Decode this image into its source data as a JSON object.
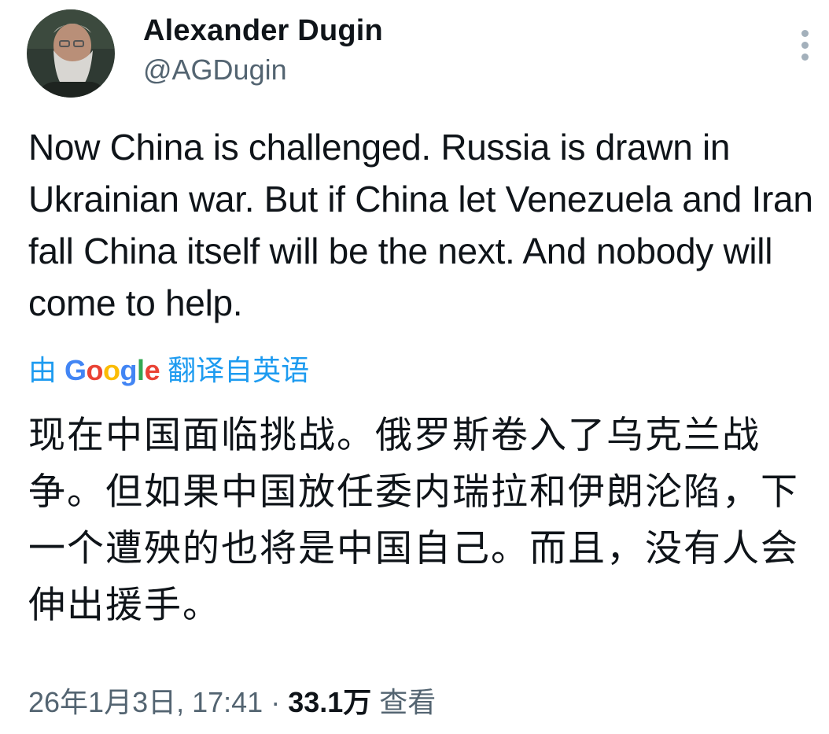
{
  "author": {
    "name": "Alexander Dugin",
    "handle": "@AGDugin",
    "avatar_icon": "profile-photo"
  },
  "tweet": {
    "text": "Now China is challenged. Russia is drawn in Ukrainian war. But if China let Venezuela and Iran fall China itself will be the next. And nobody will come to help."
  },
  "translation": {
    "prefix": "由",
    "provider": "Google",
    "suffix": "翻译自英语",
    "text": "现在中国面临挑战。俄罗斯卷入了乌克兰战争。但如果中国放任委内瑞拉和伊朗沦陷，下一个遭殃的也将是中国自己。而且，没有人会伸出援手。"
  },
  "meta": {
    "timestamp": "26年1月3日, 17:41",
    "separator": " · ",
    "views": "33.1万",
    "views_label": " 查看"
  },
  "colors": {
    "accent": "#1d9bf0",
    "secondary_text": "#536471",
    "primary_text": "#0f1419"
  }
}
